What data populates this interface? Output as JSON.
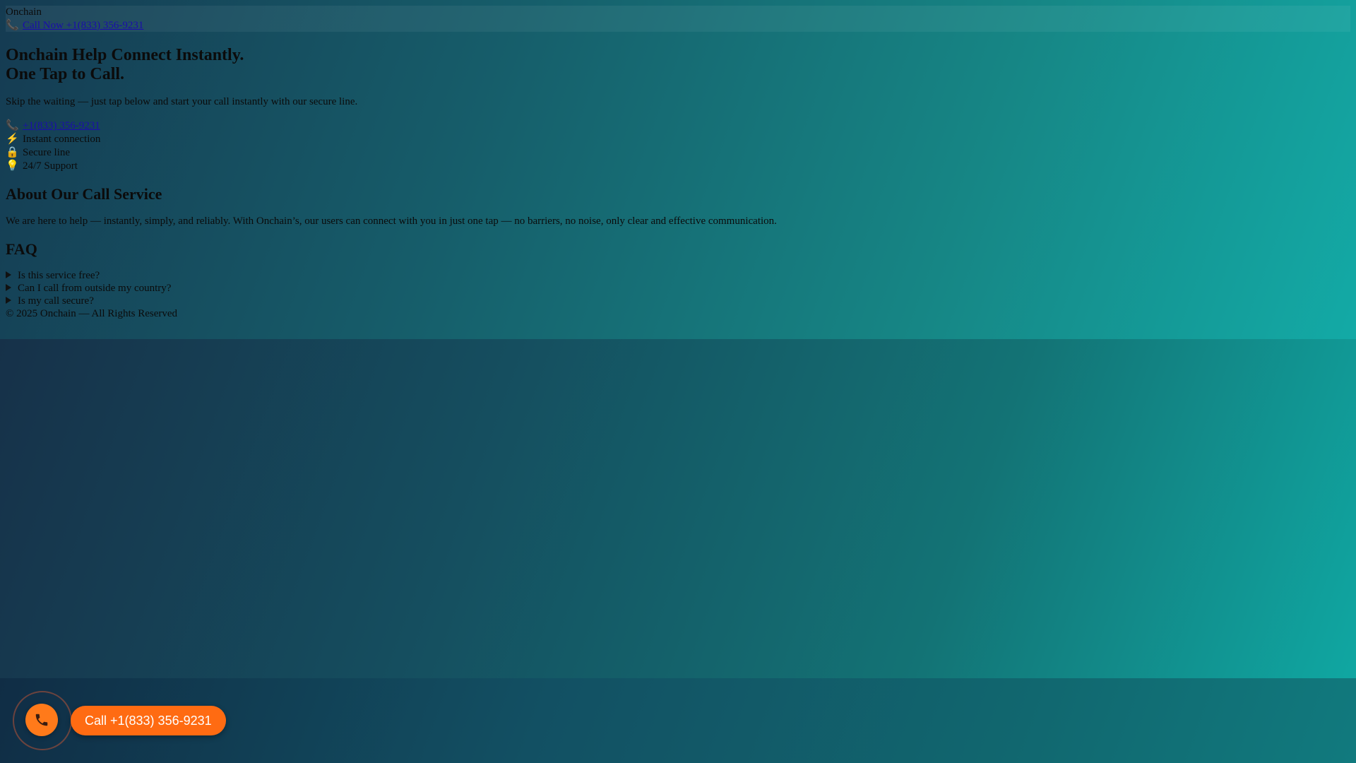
{
  "colors": {
    "gradient_left": "#102d44",
    "gradient_right": "#12a8a6",
    "link": "#1a0dab",
    "cta_orange": "#ff6b12"
  },
  "header": {
    "brand": "Onchain",
    "call_icon": "phone-icon",
    "call_link": "Call Now +1(833) 356-9231"
  },
  "hero": {
    "title_line1": "Onchain Help Connect Instantly.",
    "title_line2": "One Tap to Call.",
    "subtitle": "Skip the waiting — just tap below and start your call instantly with our secure line."
  },
  "features": [
    {
      "icon": "phone-icon",
      "label": "+1(833) 356-9231"
    },
    {
      "icon": "lightning-icon",
      "label": "Instant connection"
    },
    {
      "icon": "lock-icon",
      "label": "Secure line"
    },
    {
      "icon": "lightbulb-icon",
      "label": "24/7 Support"
    }
  ],
  "about": {
    "heading": "About Our Call Service",
    "text": "We are here to help — instantly, simply, and reliably. With Onchain’s, our users can connect with you in just one tap — no barriers, no noise, only clear and effective communication."
  },
  "faq": {
    "heading": "FAQ",
    "items": [
      "Is this service free?",
      "Can I call from outside my country?",
      "Is my call secure?"
    ]
  },
  "footer": {
    "text": "© 2025 Onchain — All Rights Reserved"
  },
  "floating": {
    "icon": "phone-icon",
    "cta_label": "Call +1(833) 356-9231"
  }
}
